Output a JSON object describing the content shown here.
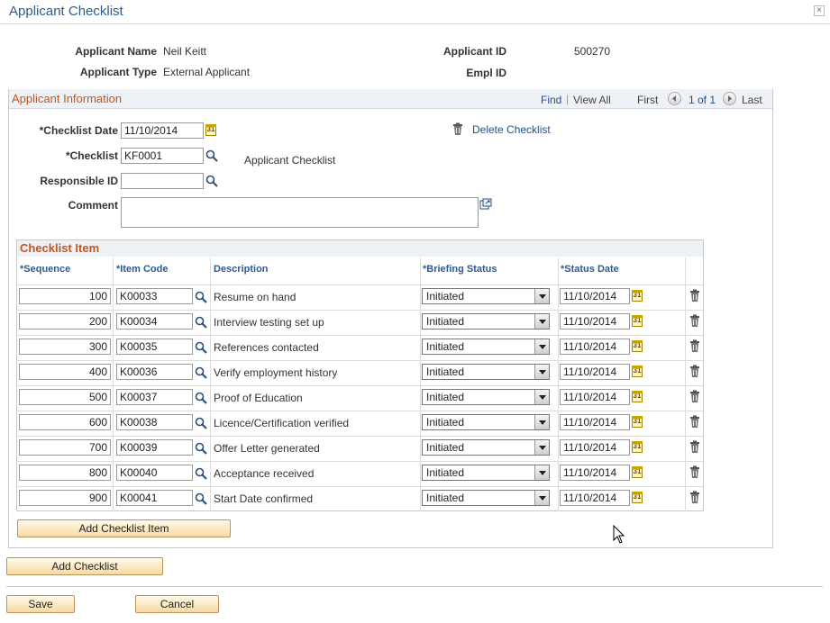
{
  "window": {
    "title": "Applicant Checklist",
    "close_glyph": "×"
  },
  "header": {
    "applicant_name_label": "Applicant Name",
    "applicant_name": "Neil Keitt",
    "applicant_type_label": "Applicant Type",
    "applicant_type": "External Applicant",
    "applicant_id_label": "Applicant ID",
    "applicant_id": "500270",
    "empl_id_label": "Empl ID",
    "empl_id": ""
  },
  "info_panel": {
    "title": "Applicant Information",
    "find_label": "Find",
    "separator": "|",
    "view_all_label": "View All",
    "first_label": "First",
    "page_label": "1 of 1",
    "last_label": "Last",
    "checklist_date_label": "*Checklist Date",
    "checklist_date": "11/10/2014",
    "checklist_label": "*Checklist",
    "checklist_code": "KF0001",
    "checklist_desc": "Applicant Checklist",
    "responsible_id_label": "Responsible ID",
    "responsible_id": "",
    "comment_label": "Comment",
    "comment": "",
    "delete_checklist_label": "Delete Checklist"
  },
  "checklist_grid": {
    "title": "Checklist Item",
    "columns": {
      "sequence": "*Sequence",
      "item_code": "*Item Code",
      "description": "Description",
      "briefing_status": "*Briefing Status",
      "status_date": "*Status Date"
    },
    "rows": [
      {
        "sequence": "100",
        "item_code": "K00033",
        "description": "Resume on hand",
        "briefing_status": "Initiated",
        "status_date": "11/10/2014"
      },
      {
        "sequence": "200",
        "item_code": "K00034",
        "description": "Interview testing set up",
        "briefing_status": "Initiated",
        "status_date": "11/10/2014"
      },
      {
        "sequence": "300",
        "item_code": "K00035",
        "description": "References contacted",
        "briefing_status": "Initiated",
        "status_date": "11/10/2014"
      },
      {
        "sequence": "400",
        "item_code": "K00036",
        "description": "Verify employment history",
        "briefing_status": "Initiated",
        "status_date": "11/10/2014"
      },
      {
        "sequence": "500",
        "item_code": "K00037",
        "description": "Proof of Education",
        "briefing_status": "Initiated",
        "status_date": "11/10/2014"
      },
      {
        "sequence": "600",
        "item_code": "K00038",
        "description": "Licence/Certification verified",
        "briefing_status": "Initiated",
        "status_date": "11/10/2014"
      },
      {
        "sequence": "700",
        "item_code": "K00039",
        "description": "Offer Letter generated",
        "briefing_status": "Initiated",
        "status_date": "11/10/2014"
      },
      {
        "sequence": "800",
        "item_code": "K00040",
        "description": "Acceptance received",
        "briefing_status": "Initiated",
        "status_date": "11/10/2014"
      },
      {
        "sequence": "900",
        "item_code": "K00041",
        "description": "Start Date confirmed",
        "briefing_status": "Initiated",
        "status_date": "11/10/2014"
      }
    ],
    "add_item_label": "Add Checklist Item"
  },
  "footer": {
    "add_checklist_label": "Add Checklist",
    "save_label": "Save",
    "cancel_label": "Cancel"
  },
  "colors": {
    "accent_title": "#2f5a8f",
    "section_title": "#c1561b",
    "link": "#1f4e8c",
    "button_fill": "#f6d9a3"
  },
  "icons": [
    "close-icon",
    "calendar-icon",
    "search-icon",
    "trash-icon",
    "expand-icon",
    "nav-first-icon",
    "nav-last-icon"
  ]
}
